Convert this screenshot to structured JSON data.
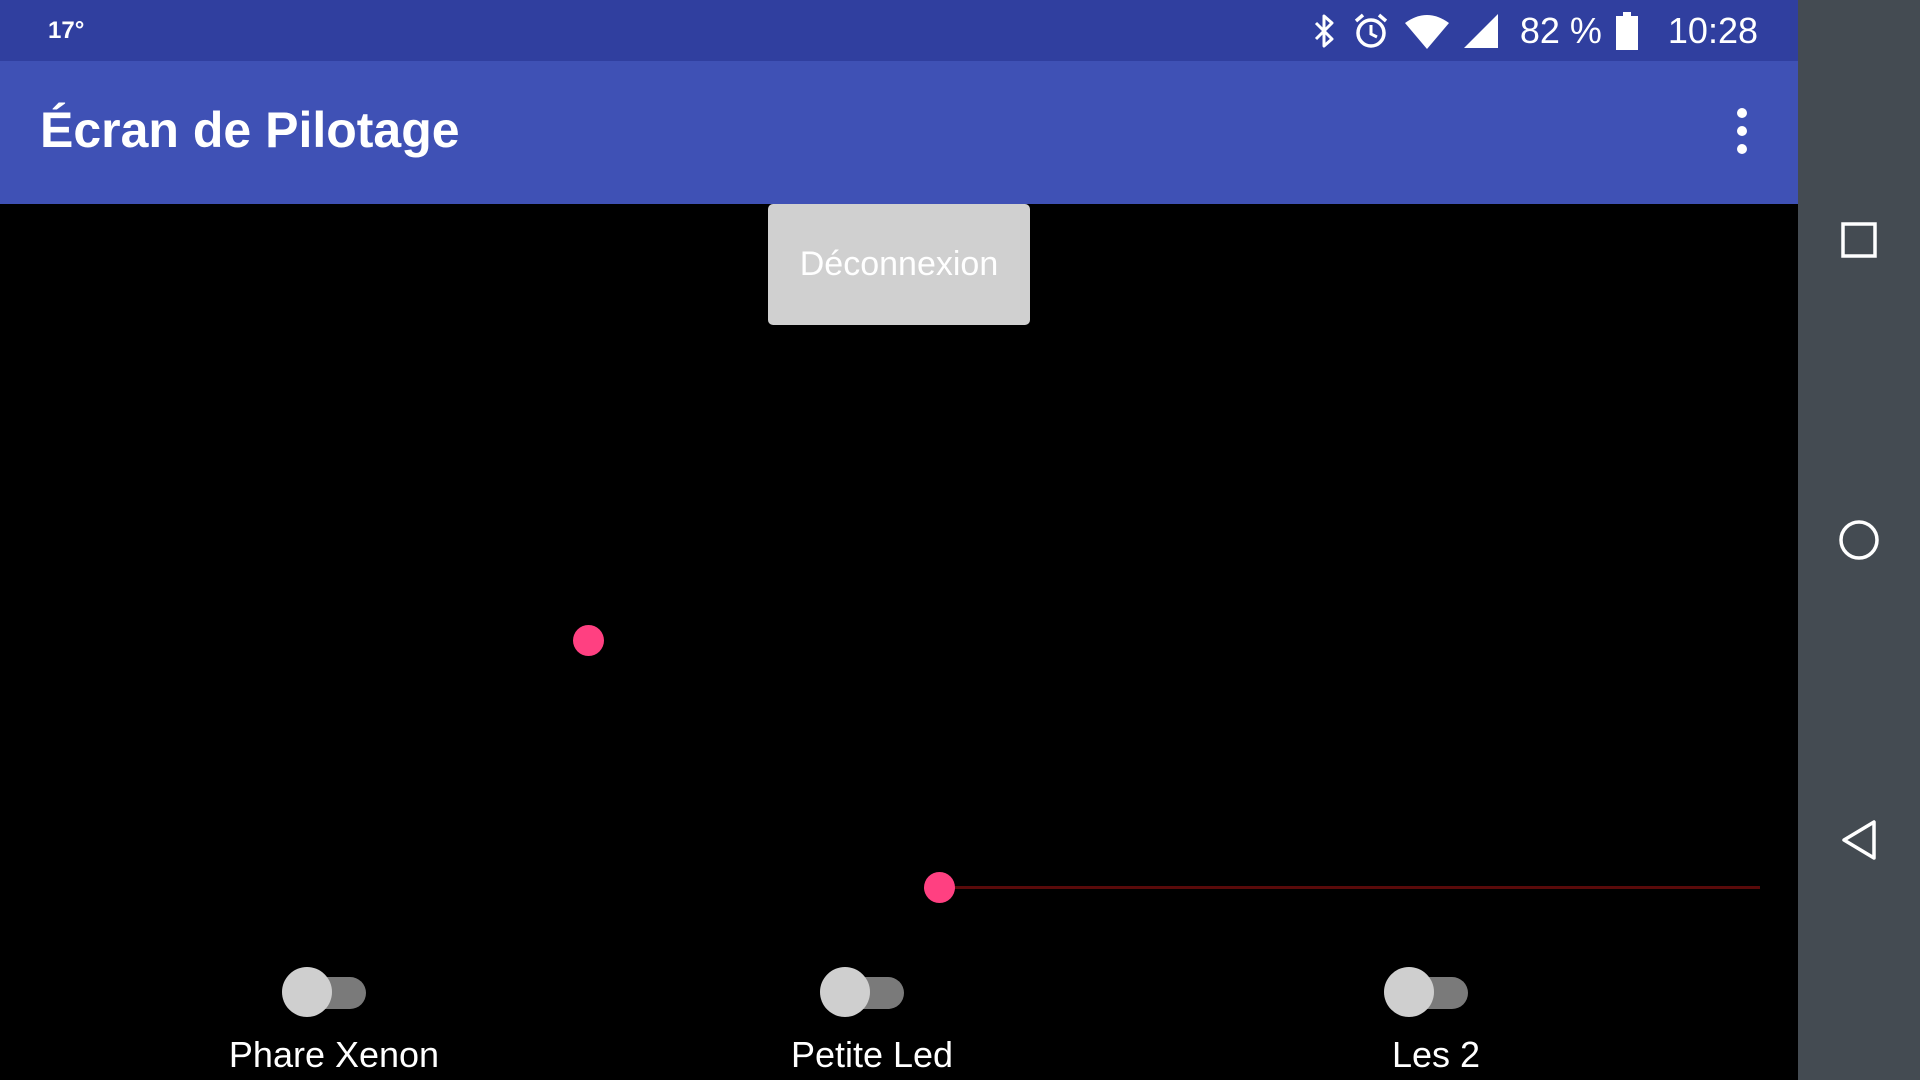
{
  "status_bar": {
    "temperature": "17°",
    "battery_percent": "82 %",
    "time": "10:28",
    "icons": [
      "bluetooth-icon",
      "alarm-icon",
      "wifi-icon",
      "cell-signal-icon",
      "battery-icon"
    ]
  },
  "app_bar": {
    "title": "Écran de Pilotage",
    "overflow_icon": "more-vert-icon"
  },
  "content": {
    "disconnect_label": "Déconnexion",
    "switches": [
      {
        "label": "Phare Xenon",
        "checked": false
      },
      {
        "label": "Petite Led",
        "checked": false
      },
      {
        "label": "Les 2",
        "checked": false
      }
    ],
    "seekbar": {
      "progress_percent": 0
    }
  },
  "nav_bar": {
    "icons": [
      "recents-square-icon",
      "home-circle-icon",
      "back-triangle-icon"
    ]
  },
  "colors": {
    "status_bar": "#303f9f",
    "app_bar": "#3f51b5",
    "accent": "#ff4081",
    "background": "#000000",
    "nav_bar": "#444b52"
  }
}
